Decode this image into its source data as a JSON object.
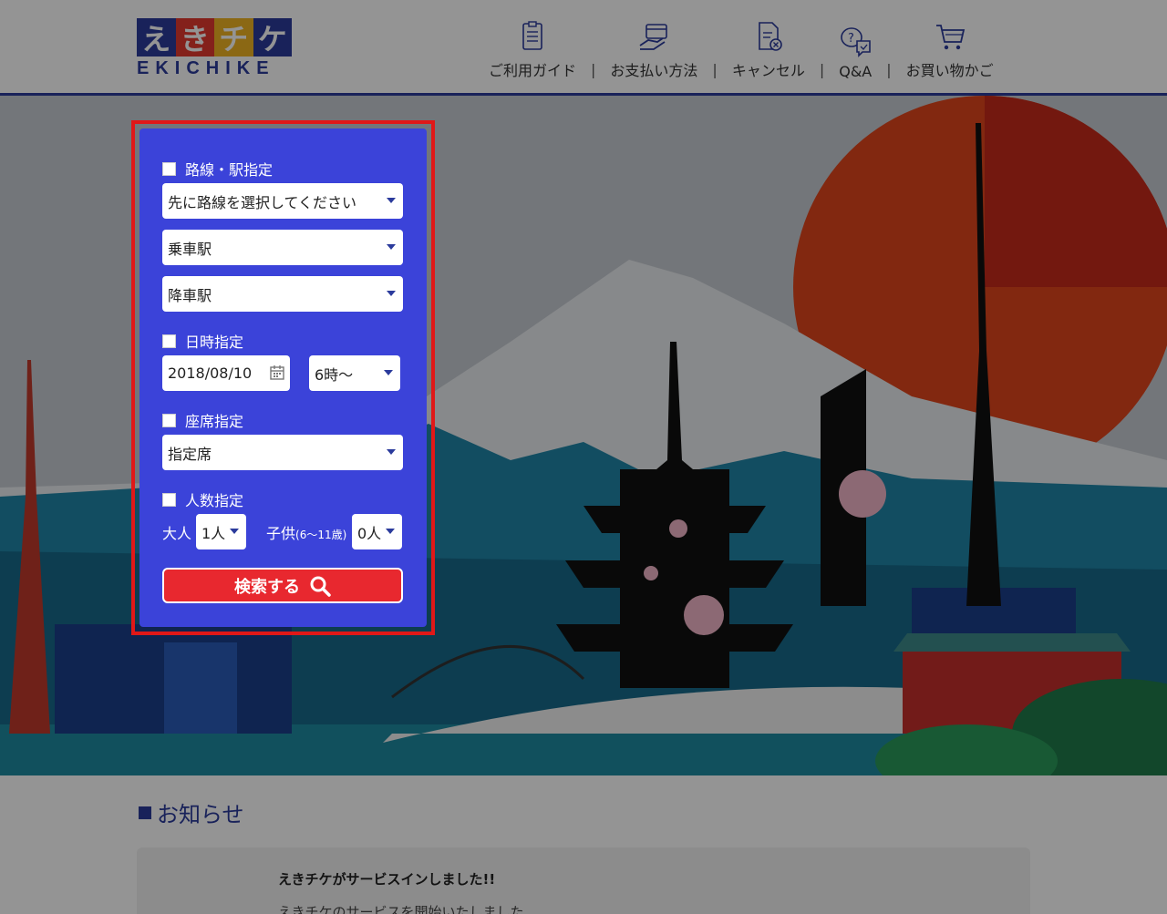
{
  "logo": {
    "chars": [
      "え",
      "き",
      "チ",
      "ケ"
    ],
    "block_colors": [
      "#2b3b9c",
      "#e33a2f",
      "#f0b323",
      "#2b3b9c"
    ],
    "subtitle": "EKICHIKE"
  },
  "nav": {
    "items": [
      {
        "label": "ご利用ガイド",
        "icon": "guide-clipboard-icon"
      },
      {
        "label": "お支払い方法",
        "icon": "payment-card-icon"
      },
      {
        "label": "キャンセル",
        "icon": "cancel-document-icon"
      },
      {
        "label": "Q&A",
        "icon": "qa-speech-icon"
      },
      {
        "label": "お買い物かご",
        "icon": "cart-icon"
      }
    ],
    "separator": "|"
  },
  "search": {
    "route_label": "路線・駅指定",
    "line_select": "先に路線を選択してください",
    "board_select": "乗車駅",
    "alight_select": "降車駅",
    "datetime_label": "日時指定",
    "date_value": "2018/08/10",
    "time_select": "6時～",
    "seat_label": "座席指定",
    "seat_select": "指定席",
    "people_label": "人数指定",
    "adult_label": "大人",
    "adult_select": "1人",
    "child_label": "子供",
    "child_age": "(6～11歳)",
    "child_select": "0人",
    "search_button": "検索する"
  },
  "news": {
    "title": "お知らせ",
    "headline": "えきチケがサービスインしました!!",
    "body": "えきチケのサービスを開始いたしました"
  },
  "colors": {
    "brand_blue": "#2b3b9c",
    "panel_blue": "#3b43d9",
    "highlight_red": "#e01818",
    "button_red": "#e8282f"
  }
}
